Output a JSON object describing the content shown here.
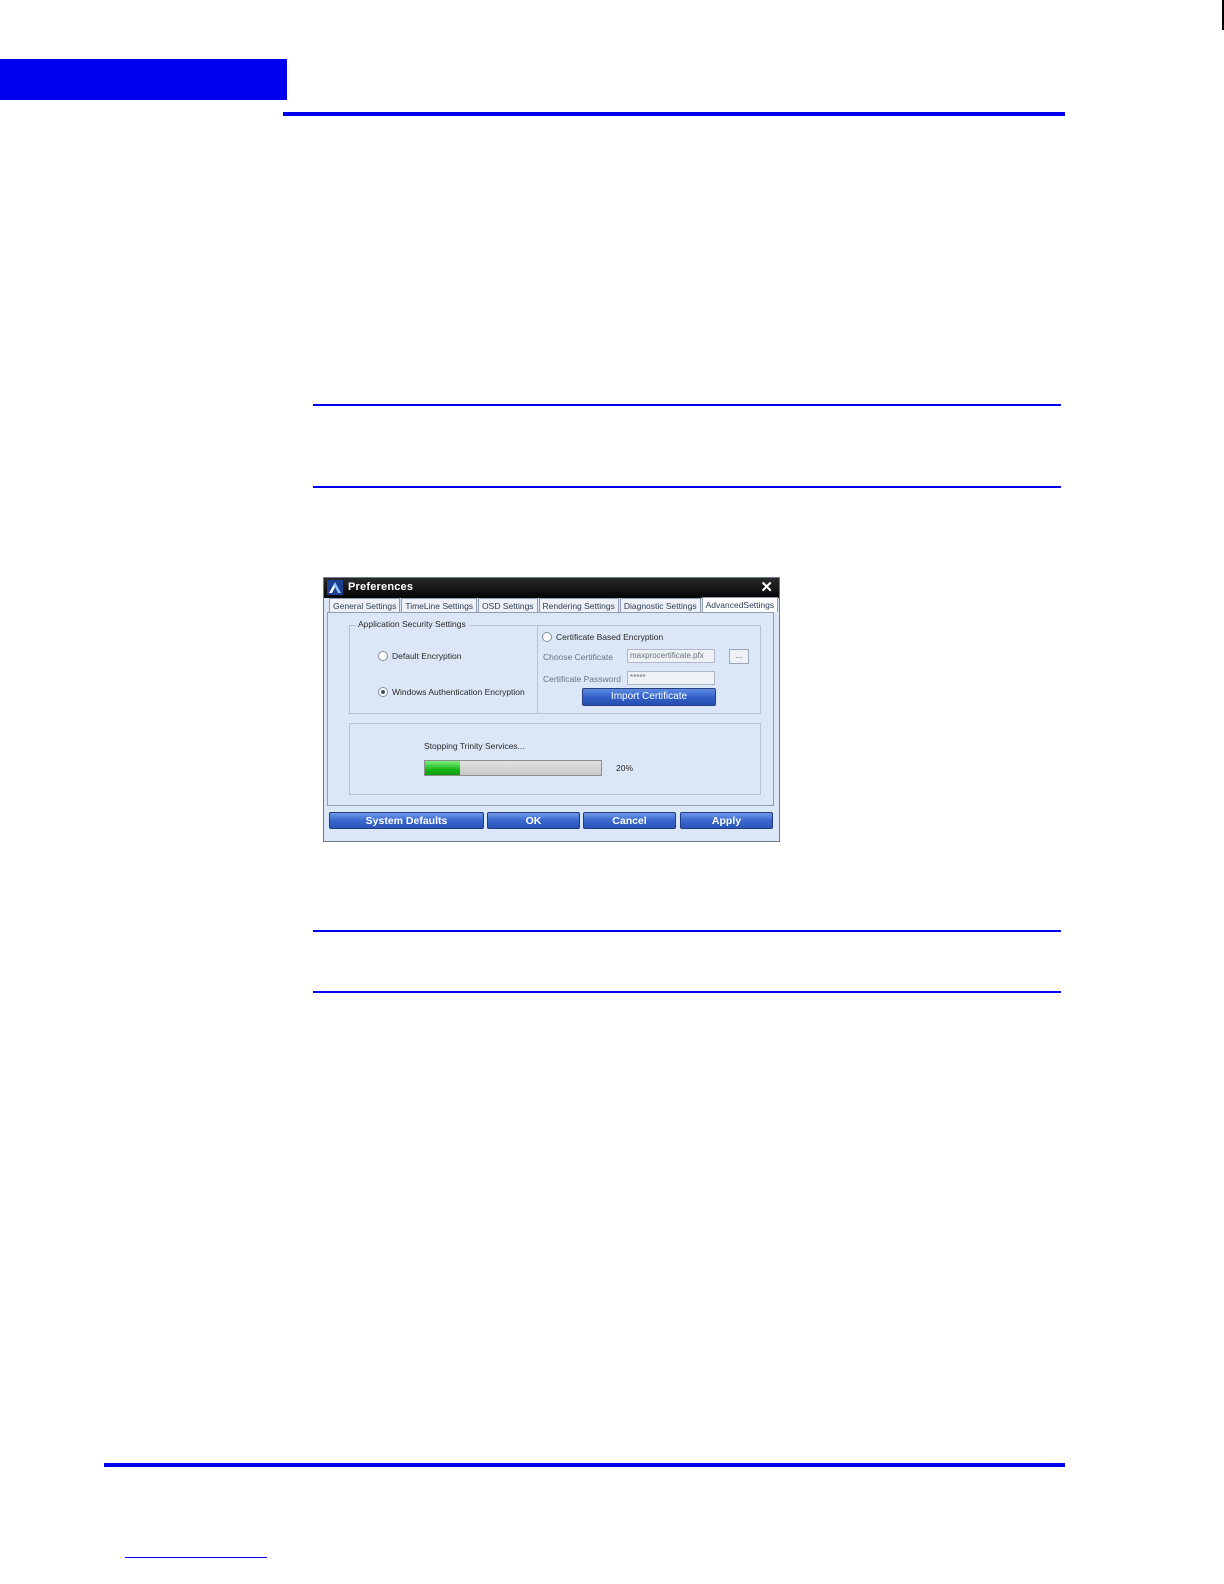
{
  "dialog": {
    "title": "Preferences",
    "close_glyph": "✕",
    "icons": {
      "app": "app-logo-icon",
      "close": "close-icon"
    },
    "tabs": [
      {
        "label": "General Settings",
        "active": false
      },
      {
        "label": "TimeLine Settings",
        "active": false
      },
      {
        "label": "OSD Settings",
        "active": false
      },
      {
        "label": "Rendering Settings",
        "active": false
      },
      {
        "label": "Diagnostic Settings",
        "active": false
      },
      {
        "label": "AdvancedSettings",
        "active": true
      }
    ],
    "security": {
      "group_label": "Application Security Settings",
      "default_encryption": {
        "label": "Default Encryption",
        "selected": false
      },
      "windows_auth_encryption": {
        "label": "Windows Authentication Encryption",
        "selected": true
      },
      "certificate_encryption": {
        "label": "Certificate Based Encryption",
        "selected": false
      },
      "choose_certificate_label": "Choose Certificate",
      "certificate_file": "maxprocertificate.pfx",
      "browse_label": "...",
      "certificate_password_label": "Certificate Password",
      "certificate_password": "*****",
      "import_button": "Import Certificate"
    },
    "progress": {
      "status": "Stopping Trinity Services...",
      "percent_label": "20%",
      "fraction": 0.2
    },
    "buttons": {
      "system_defaults": "System Defaults",
      "ok": "OK",
      "cancel": "Cancel",
      "apply": "Apply"
    }
  },
  "colors": {
    "accent_blue": "#0000ee",
    "dialog_bg": "#dbe6f6",
    "titlebar": "#111111",
    "button_blue": "#3a68cf",
    "progress_green": "#18b718"
  }
}
